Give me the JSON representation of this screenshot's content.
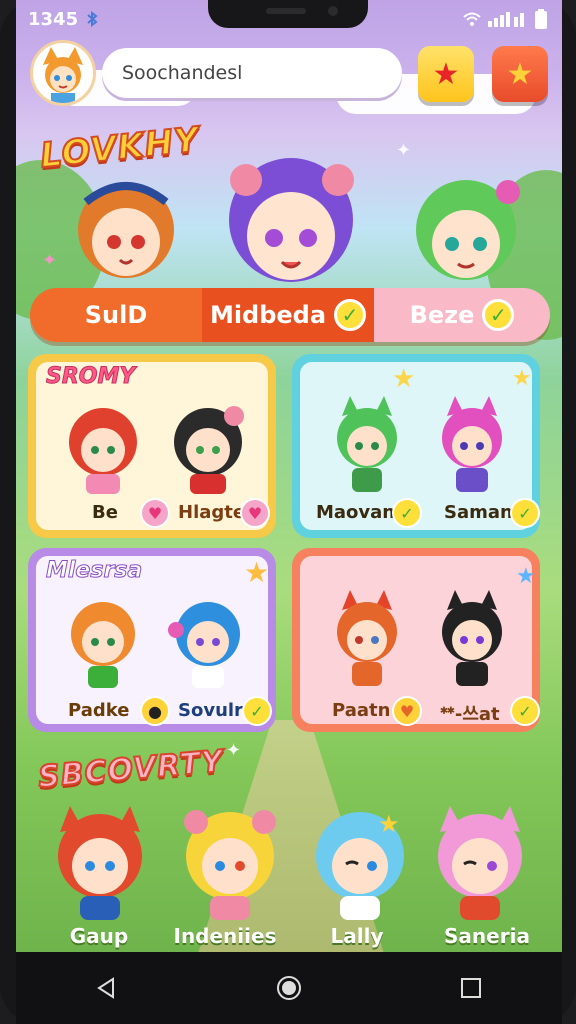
{
  "status": {
    "time": "1345",
    "bluetooth_icon": "bluetooth-icon",
    "wifi_icon": "wifi-icon",
    "signal_icon": "signal-icon",
    "battery_icon": "battery-icon"
  },
  "header": {
    "search_value": "Soochandesl"
  },
  "sections": {
    "top_title": "LOVKHY",
    "bottom_title": "SBCOVRTY"
  },
  "tabs": [
    {
      "label": "SulD"
    },
    {
      "label": "Midbeda"
    },
    {
      "label": "Beze"
    }
  ],
  "cards": [
    {
      "title": "SROMY",
      "names": [
        "Be",
        "Hlagte"
      ]
    },
    {
      "title": "",
      "names": [
        "Maovan",
        "Saman"
      ]
    },
    {
      "title": "Mlesrsa",
      "names": [
        "Padke",
        "Sovulr"
      ]
    },
    {
      "title": "",
      "names": [
        "Paatn",
        "ᕯ-쓰at"
      ]
    }
  ],
  "bottom_characters": [
    "Gaup",
    "Indeniies",
    "Lally",
    "Saneria"
  ],
  "colors": {
    "orange": "#f16b2b",
    "yellow": "#ffe03a",
    "pink": "#f9b9c6",
    "green": "#3cae3a"
  }
}
